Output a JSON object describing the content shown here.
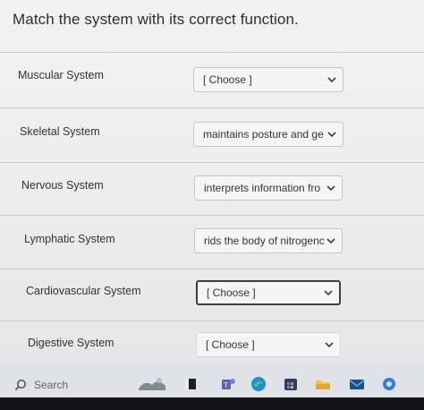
{
  "question": {
    "title": "Match the system with its correct function."
  },
  "rows": [
    {
      "label": "Muscular System",
      "value": "[ Choose ]"
    },
    {
      "label": "Skeletal System",
      "value": "maintains posture and ge"
    },
    {
      "label": "Nervous System",
      "value": "interprets information fro"
    },
    {
      "label": "Lymphatic System",
      "value": "rids the body of nitrogenc"
    },
    {
      "label": "Cardiovascular System",
      "value": "[ Choose ]"
    },
    {
      "label": "Digestive System",
      "value": "[ Choose ]"
    }
  ],
  "taskbar": {
    "search_placeholder": "Search",
    "icons": [
      "weather-icon",
      "file-explorer-icon",
      "teams-icon",
      "edge-browser-icon",
      "store-icon",
      "folder-icon",
      "mail-icon",
      "settings-icon"
    ]
  },
  "colors": {
    "page_bg": "#eceeef",
    "text": "#2f3438",
    "border": "#c3c7cb",
    "taskbar": "#dfe3e7"
  }
}
